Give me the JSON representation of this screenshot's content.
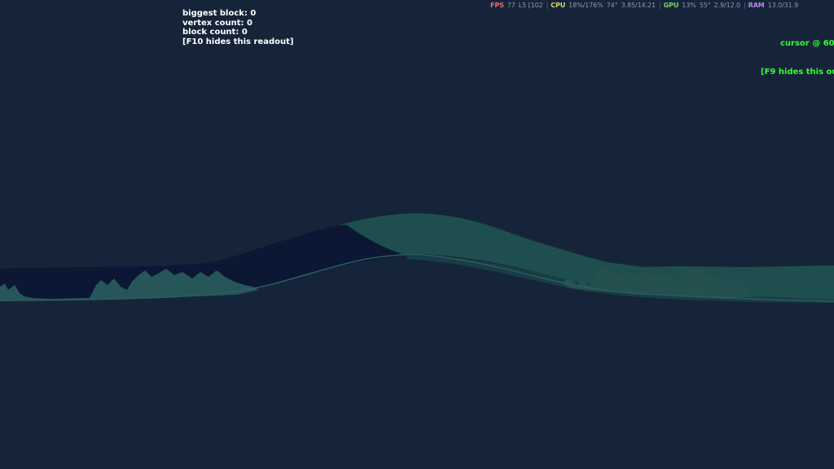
{
  "scene": {
    "background_color": "#16243a",
    "colors": {
      "deep_navy": "#0b1733",
      "teal_light": "#1e4f4e",
      "teal_dark": "#183d44",
      "foliage": "#26565a",
      "water_line": "#2b5d62",
      "ground": "#17253a"
    }
  },
  "debug_readout": {
    "biggest_block": "biggest block: 0",
    "vertex_count": "vertex count: 0",
    "block_count": "block count: 0",
    "hint": "[F10 hides this readout]"
  },
  "cursor_readout": {
    "position": "cursor @ 60",
    "hint": "[F9 hides this ou"
  },
  "perf_overlay": {
    "fps_label": "FPS",
    "fps_value": "77",
    "fps_low": "L5 [102",
    "cpu_label": "CPU",
    "cpu_value": "18%/176%",
    "cpu_temp": "74°",
    "cpu_clock": "3.85/14.21",
    "gpu_label": "GPU",
    "gpu_value": "13%",
    "gpu_temp": "55°",
    "gpu_mem": "2.9/12.0",
    "ram_label": "RAM",
    "ram_value": "13.0/31.9"
  }
}
